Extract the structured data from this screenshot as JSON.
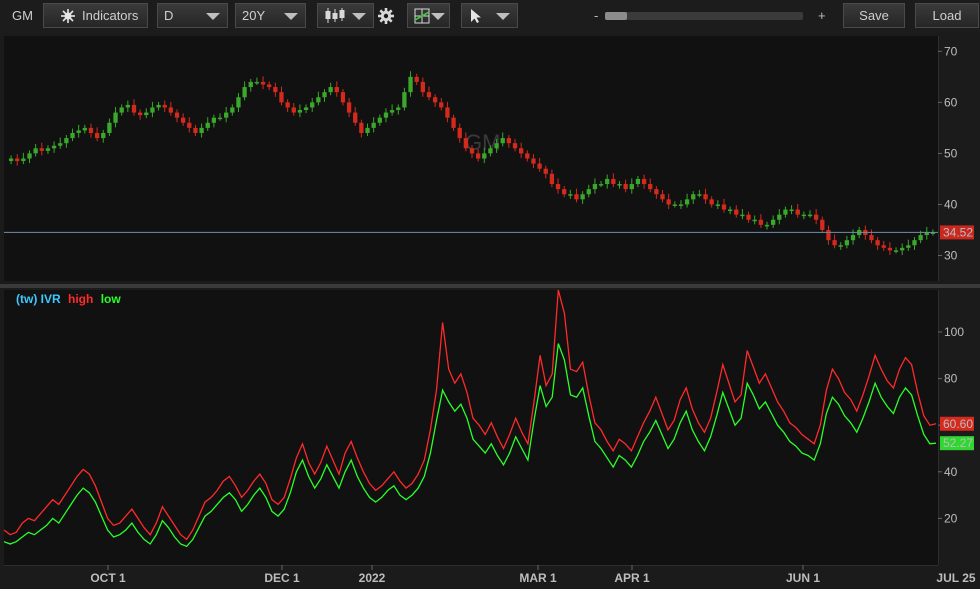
{
  "toolbar": {
    "symbol": "GM",
    "indicators_label": "Indicators",
    "period_value": "D",
    "range_value": "20Y",
    "zoom_minus": "-",
    "zoom_plus": "+",
    "save_label": "Save",
    "load_label": "Load"
  },
  "chart_data": [
    {
      "type": "candlestick",
      "title": "",
      "watermark": "GM",
      "ylim": [
        25,
        73
      ],
      "y_ticks": [
        30,
        40,
        50,
        60,
        70
      ],
      "last_price_label": "34.52",
      "last_price": 34.52,
      "grid": false,
      "up_color": "#3aa82a",
      "down_color": "#d42a1e",
      "close_series": [
        49,
        48.5,
        49,
        50,
        51,
        50.5,
        51,
        51.5,
        52,
        53,
        54,
        54.5,
        55,
        54,
        53,
        54,
        56,
        58,
        59,
        59.5,
        58,
        57.5,
        58,
        59,
        59.5,
        59,
        58,
        57,
        56,
        55,
        54,
        55,
        56,
        57,
        57,
        58,
        59,
        61,
        63,
        64,
        64,
        63.5,
        63,
        62,
        60,
        59,
        58,
        58.5,
        59,
        60,
        61,
        62,
        63,
        62,
        60,
        58,
        56,
        54,
        55,
        56,
        57,
        58,
        58.5,
        59,
        62,
        65,
        64,
        62,
        61,
        60,
        59,
        57,
        55,
        53,
        51,
        50,
        49,
        50,
        51,
        52,
        53,
        52,
        51,
        50,
        49,
        48,
        47,
        46,
        44,
        43,
        42,
        42,
        41,
        42,
        43,
        44,
        44,
        45,
        44,
        44,
        43,
        44,
        45,
        44,
        43,
        42,
        41,
        40,
        40,
        40,
        41,
        42,
        42,
        41,
        40,
        40,
        39,
        39,
        38,
        38,
        37,
        37,
        36,
        36,
        37,
        38,
        39,
        39,
        38,
        38,
        38,
        37,
        35,
        33,
        32,
        32,
        33,
        34,
        35,
        34,
        33,
        32,
        31.5,
        31,
        31,
        31.5,
        32,
        33,
        34,
        34.5,
        34.52
      ]
    },
    {
      "type": "line",
      "title": "",
      "legend": [
        {
          "name": "(tw) IVR",
          "color": "#3ec8ff"
        },
        {
          "name": "high",
          "color": "#ff2a2a"
        },
        {
          "name": "low",
          "color": "#2aff2a"
        }
      ],
      "ylim": [
        0,
        118
      ],
      "y_ticks": [
        20,
        40,
        60,
        80,
        100
      ],
      "x_tick_labels": [
        "OCT 1",
        "DEC 1",
        "2022",
        "MAR 1",
        "APR 1",
        "JUN 1",
        "JUL 25"
      ],
      "series": [
        {
          "name": "high",
          "color": "#ff2a2a",
          "last_label": "60.60",
          "values": [
            15,
            13,
            14,
            18,
            20,
            19,
            22,
            25,
            28,
            26,
            30,
            34,
            38,
            41,
            39,
            34,
            27,
            20,
            17,
            18,
            21,
            24,
            20,
            16,
            13,
            18,
            25,
            21,
            17,
            13,
            11,
            15,
            21,
            27,
            29,
            32,
            36,
            38,
            34,
            29,
            32,
            36,
            39,
            35,
            28,
            26,
            29,
            37,
            46,
            52,
            44,
            39,
            44,
            51,
            45,
            39,
            48,
            53,
            46,
            40,
            35,
            32,
            34,
            37,
            40,
            36,
            33,
            35,
            39,
            45,
            58,
            75,
            104,
            84,
            78,
            82,
            74,
            63,
            60,
            56,
            61,
            55,
            50,
            56,
            63,
            57,
            52,
            70,
            90,
            77,
            82,
            118,
            108,
            84,
            83,
            87,
            73,
            61,
            58,
            53,
            49,
            54,
            52,
            49,
            55,
            61,
            66,
            72,
            65,
            58,
            62,
            71,
            76,
            67,
            61,
            57,
            63,
            74,
            86,
            78,
            70,
            73,
            92,
            85,
            78,
            82,
            76,
            70,
            66,
            61,
            59,
            56,
            54,
            52,
            60,
            75,
            84,
            80,
            74,
            71,
            66,
            73,
            81,
            90,
            84,
            79,
            76,
            84,
            89,
            86,
            74,
            64,
            60,
            60.6
          ]
        },
        {
          "name": "low",
          "color": "#2aff2a",
          "last_label": "52.27",
          "values": [
            10,
            9,
            10,
            12,
            14,
            13,
            15,
            17,
            20,
            18,
            22,
            26,
            30,
            33,
            31,
            27,
            21,
            15,
            12,
            13,
            15,
            18,
            14,
            11,
            9,
            13,
            19,
            16,
            12,
            9,
            8,
            11,
            16,
            21,
            23,
            26,
            29,
            31,
            28,
            23,
            26,
            30,
            33,
            29,
            23,
            21,
            24,
            31,
            40,
            45,
            38,
            33,
            37,
            43,
            38,
            33,
            40,
            45,
            38,
            33,
            29,
            27,
            29,
            32,
            34,
            30,
            28,
            30,
            33,
            38,
            48,
            62,
            75,
            70,
            66,
            69,
            63,
            54,
            51,
            48,
            52,
            47,
            43,
            48,
            55,
            50,
            45,
            62,
            77,
            68,
            72,
            95,
            88,
            73,
            72,
            76,
            64,
            53,
            50,
            46,
            42,
            47,
            45,
            42,
            47,
            53,
            57,
            62,
            56,
            50,
            54,
            61,
            66,
            58,
            53,
            49,
            55,
            64,
            74,
            67,
            60,
            63,
            78,
            73,
            67,
            70,
            65,
            60,
            57,
            53,
            51,
            48,
            47,
            45,
            52,
            65,
            72,
            69,
            64,
            61,
            57,
            63,
            70,
            78,
            72,
            68,
            65,
            72,
            76,
            73,
            64,
            56,
            52,
            52.27
          ]
        }
      ]
    }
  ]
}
